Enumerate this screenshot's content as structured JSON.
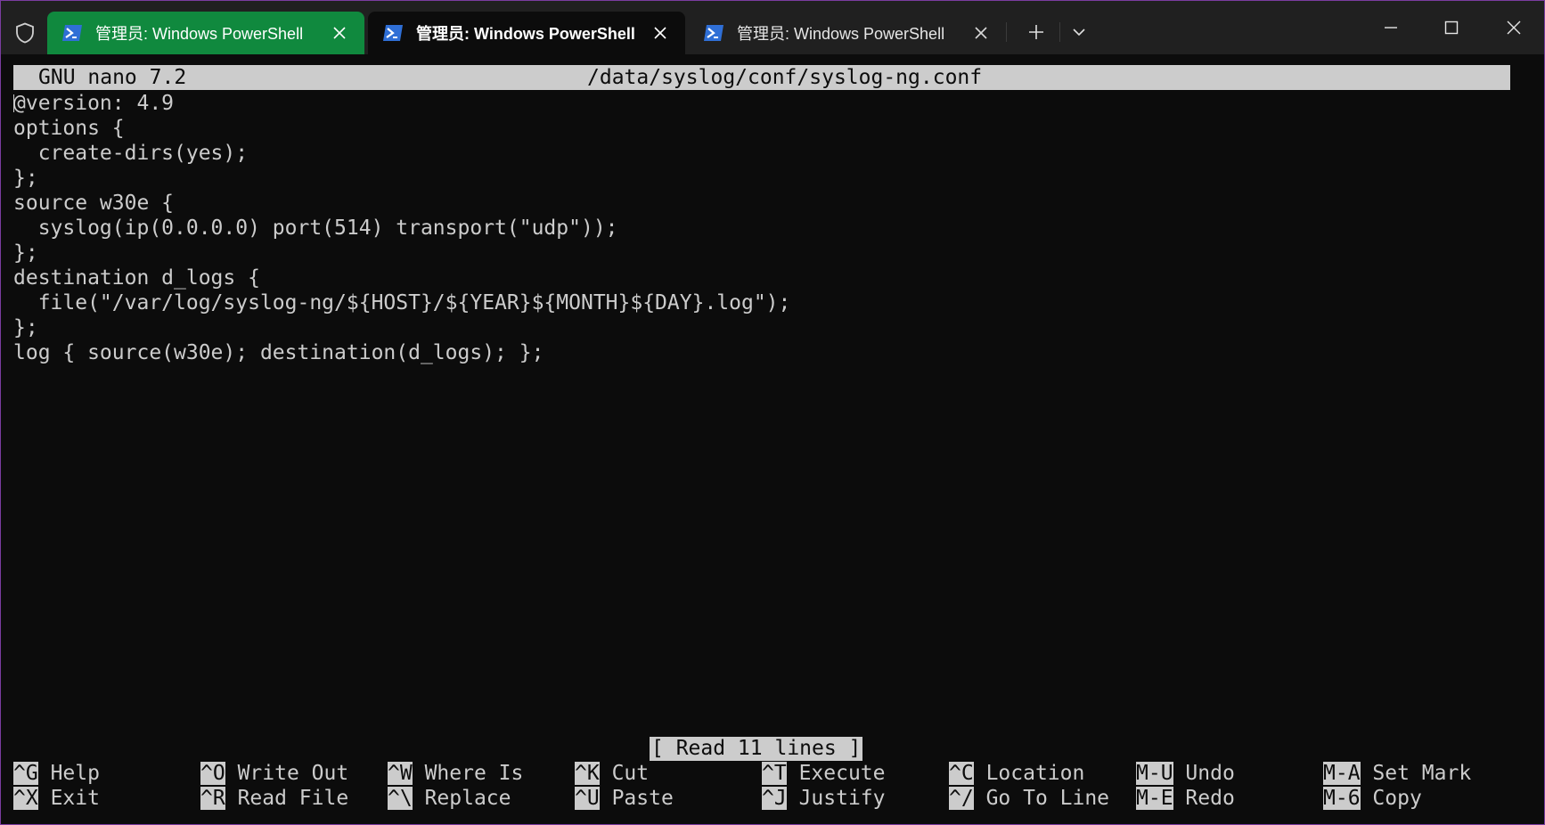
{
  "tabs": [
    {
      "label": "管理员: Windows PowerShell",
      "state": "inactive"
    },
    {
      "label": "管理员: Windows PowerShell",
      "state": "active"
    },
    {
      "label": "管理员: Windows PowerShell",
      "state": "inactive"
    }
  ],
  "colors": {
    "accent_tab": "#10893e",
    "titlebar": "#202020",
    "terminal_bg": "#0c0c0c",
    "terminal_fg": "#cccccc",
    "powershell_icon": "#2f6fd6"
  },
  "icons": {
    "shield": "shield-icon",
    "powershell": "powershell-icon",
    "close": "close-icon",
    "new_tab": "plus-icon",
    "dropdown": "chevron-down-icon",
    "minimize": "minimize-icon",
    "maximize": "maximize-icon",
    "window_close": "close-icon"
  },
  "nano": {
    "version": "GNU nano 7.2",
    "filename": "/data/syslog/conf/syslog-ng.conf",
    "lines": [
      "@version: 4.9",
      "options {",
      "  create-dirs(yes);",
      "};",
      "source w30e {",
      "  syslog(ip(0.0.0.0) port(514) transport(\"udp\"));",
      "};",
      "destination d_logs {",
      "  file(\"/var/log/syslog-ng/${HOST}/${YEAR}${MONTH}${DAY}.log\");",
      "};",
      "log { source(w30e); destination(d_logs); };"
    ],
    "status": "[ Read 11 lines ]",
    "shortcuts_row1": [
      {
        "key": "^G",
        "label": "Help"
      },
      {
        "key": "^O",
        "label": "Write Out"
      },
      {
        "key": "^W",
        "label": "Where Is"
      },
      {
        "key": "^K",
        "label": "Cut"
      },
      {
        "key": "^T",
        "label": "Execute"
      },
      {
        "key": "^C",
        "label": "Location"
      },
      {
        "key": "M-U",
        "label": "Undo"
      },
      {
        "key": "M-A",
        "label": "Set Mark"
      }
    ],
    "shortcuts_row2": [
      {
        "key": "^X",
        "label": "Exit"
      },
      {
        "key": "^R",
        "label": "Read File"
      },
      {
        "key": "^\\",
        "label": "Replace"
      },
      {
        "key": "^U",
        "label": "Paste"
      },
      {
        "key": "^J",
        "label": "Justify"
      },
      {
        "key": "^/",
        "label": "Go To Line"
      },
      {
        "key": "M-E",
        "label": "Redo"
      },
      {
        "key": "M-6",
        "label": "Copy"
      }
    ]
  }
}
